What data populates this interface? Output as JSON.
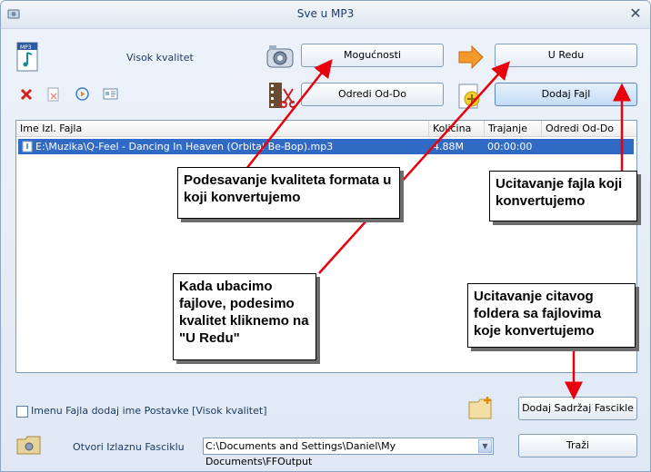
{
  "window": {
    "title": "Sve u MP3",
    "close_glyph": "✕"
  },
  "toolbar": {
    "quality_label": "Visok kvalitet",
    "options_button": "Mogućnosti",
    "ok_button": "U Redu",
    "range_button": "Odredi Od-Do",
    "add_file_button": "Dodaj Fajl"
  },
  "file_list": {
    "columns": [
      "Ime Izl. Fajla",
      "Količina",
      "Trajanje",
      "Odredi Od-Do"
    ],
    "rows": [
      {
        "name": "E:\\Muzika\\Q-Feel - Dancing In Heaven (Orbital Be-Bop).mp3",
        "size": "4.88M",
        "duration": "00:00:00",
        "range": ""
      }
    ]
  },
  "callouts": {
    "quality": "Podesavanje kvaliteta formata u koji konvertujemo",
    "add_file": "Ucitavanje fajla koji konvertujemo",
    "ok": "Kada ubacimo fajlove, podesimo kvalitet kliknemo na \"U Redu\"",
    "folder": "Ucitavanje citavog foldera sa fajlovima koje konvertujemo"
  },
  "bottom": {
    "checkbox_label": "Imenu Fajla dodaj ime Postavke [Visok kvalitet]",
    "add_folder_button": "Dodaj Sadržaj Fascikle",
    "open_output_label": "Otvori Izlaznu Fascikl‌u",
    "output_path": "C:\\Documents and Settings\\Daniel\\My Documents\\FFOutput",
    "search_button": "Traži"
  },
  "colors": {
    "arrow": "#e8000c",
    "selection": "#316ac5",
    "accent_orange": "#f08a1c"
  }
}
